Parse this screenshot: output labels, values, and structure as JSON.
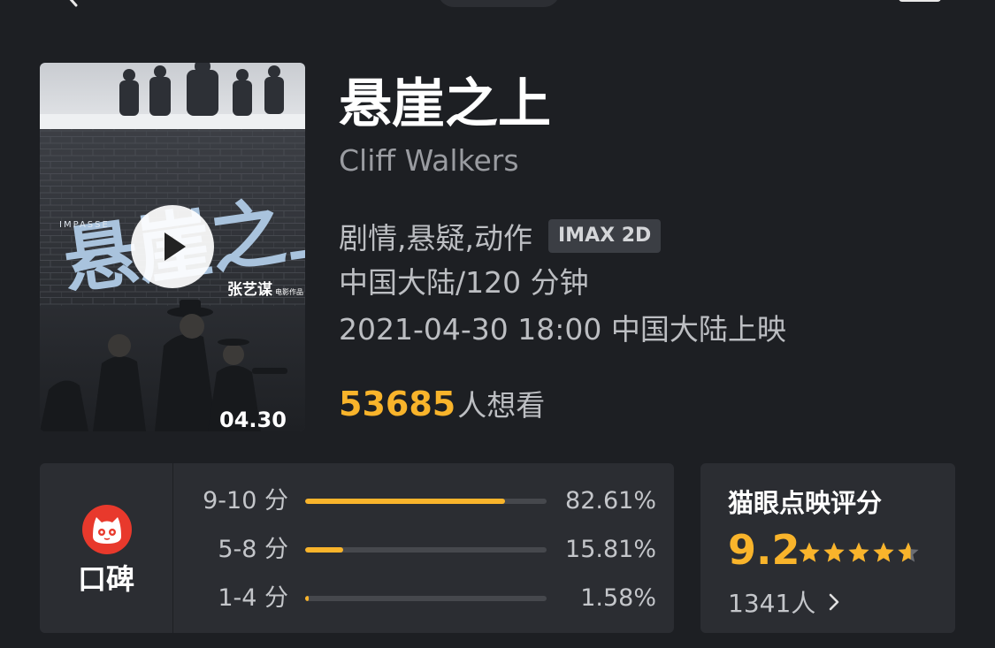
{
  "movie": {
    "title": "悬崖之上",
    "en_title": "Cliff Walkers",
    "genres": "剧情,悬疑,动作",
    "format_badge": "IMAX 2D",
    "region_duration": "中国大陆/120 分钟",
    "release": "2021-04-30 18:00 中国大陆上映",
    "want_count": "53685",
    "want_label": "人想看",
    "poster": {
      "title_art": "悬崖之上",
      "impasse": "IMPASSE",
      "director": "张艺谋",
      "director_sub": "电影作品",
      "date": "04.30"
    }
  },
  "rating": {
    "koubei_label": "口碑",
    "distribution": [
      {
        "label": "9-10 分",
        "percent_text": "82.61%",
        "percent": 82.61
      },
      {
        "label": "5-8 分",
        "percent_text": "15.81%",
        "percent": 15.81
      },
      {
        "label": "1-4 分",
        "percent_text": "1.58%",
        "percent": 1.58
      }
    ]
  },
  "score": {
    "title": "猫眼点映评分",
    "value": "9.2",
    "stars": 4.6,
    "count": "1341人"
  },
  "colors": {
    "accent": "#f9b42b",
    "background": "#1d1f23",
    "panel": "#2b2d32",
    "logo_red": "#e8392c"
  }
}
